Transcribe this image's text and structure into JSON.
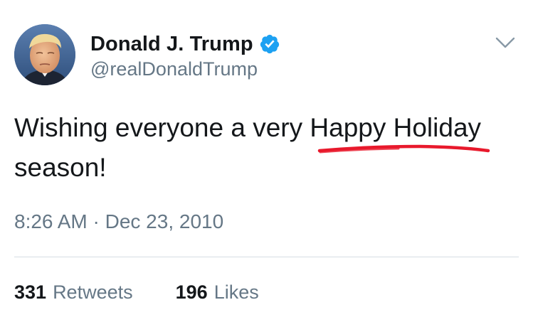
{
  "tweet": {
    "author": {
      "display_name": "Donald J. Trump",
      "handle": "@realDonaldTrump",
      "verified": true,
      "avatar_icon": "profile-photo"
    },
    "text_line_1": "Wishing everyone a very Happy Holiday",
    "text_line_2": "season!",
    "timestamp": "8:26 AM · Dec 23, 2010",
    "stats": {
      "retweets_count": "331",
      "retweets_label": "Retweets",
      "likes_count": "196",
      "likes_label": "Likes"
    },
    "menu_icon": "chevron-down-icon"
  },
  "colors": {
    "verified_badge": "#1da1f2",
    "secondary_text": "#657786",
    "annotation_underline": "#e8192c"
  }
}
